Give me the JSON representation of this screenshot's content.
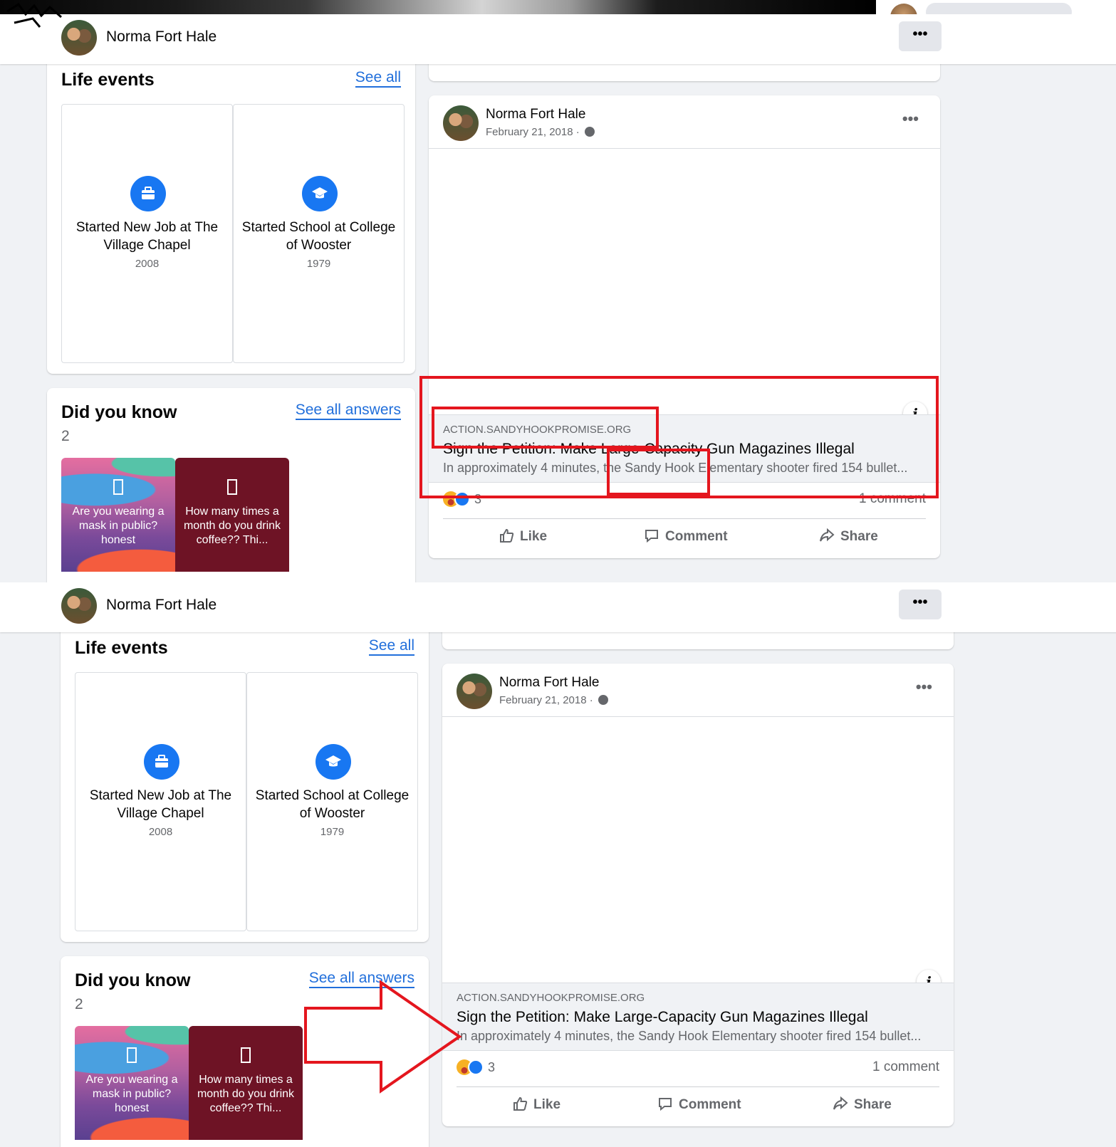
{
  "profile": {
    "name": "Norma Fort Hale",
    "more_label": "•••"
  },
  "life_events": {
    "title": "Life events",
    "see_all": "See all",
    "items": [
      {
        "title": "Started New Job at The Village Chapel",
        "year": "2008",
        "icon": "briefcase-icon"
      },
      {
        "title": "Started School at College of Wooster",
        "year": "1979",
        "icon": "graduation-cap-icon"
      }
    ]
  },
  "did_you_know": {
    "title": "Did you know",
    "see_all": "See all answers",
    "count": "2",
    "items": [
      {
        "text": "Are you wearing a mask in public? honest",
        "style": "colorful"
      },
      {
        "text": "How many times a month do you drink coffee?? Thi...",
        "style": "maroon"
      }
    ]
  },
  "post": {
    "author": "Norma Fort Hale",
    "date": "February 21, 2018 ·",
    "more_label": "•••",
    "link": {
      "domain": "ACTION.SANDYHOOKPROMISE.ORG",
      "title": "Sign the Petition: Make Large-Capacity Gun Magazines Illegal",
      "description": "In approximately 4 minutes, the Sandy Hook Elementary shooter fired 154 bullet...",
      "info_label": "i"
    },
    "reaction_count": "3",
    "comment_count": "1 comment",
    "actions": {
      "like": "Like",
      "comment": "Comment",
      "share": "Share"
    }
  },
  "colors": {
    "accent": "#1877f2",
    "link": "#216fdb",
    "annotation_red": "#e4161e",
    "background": "#f0f2f5"
  }
}
